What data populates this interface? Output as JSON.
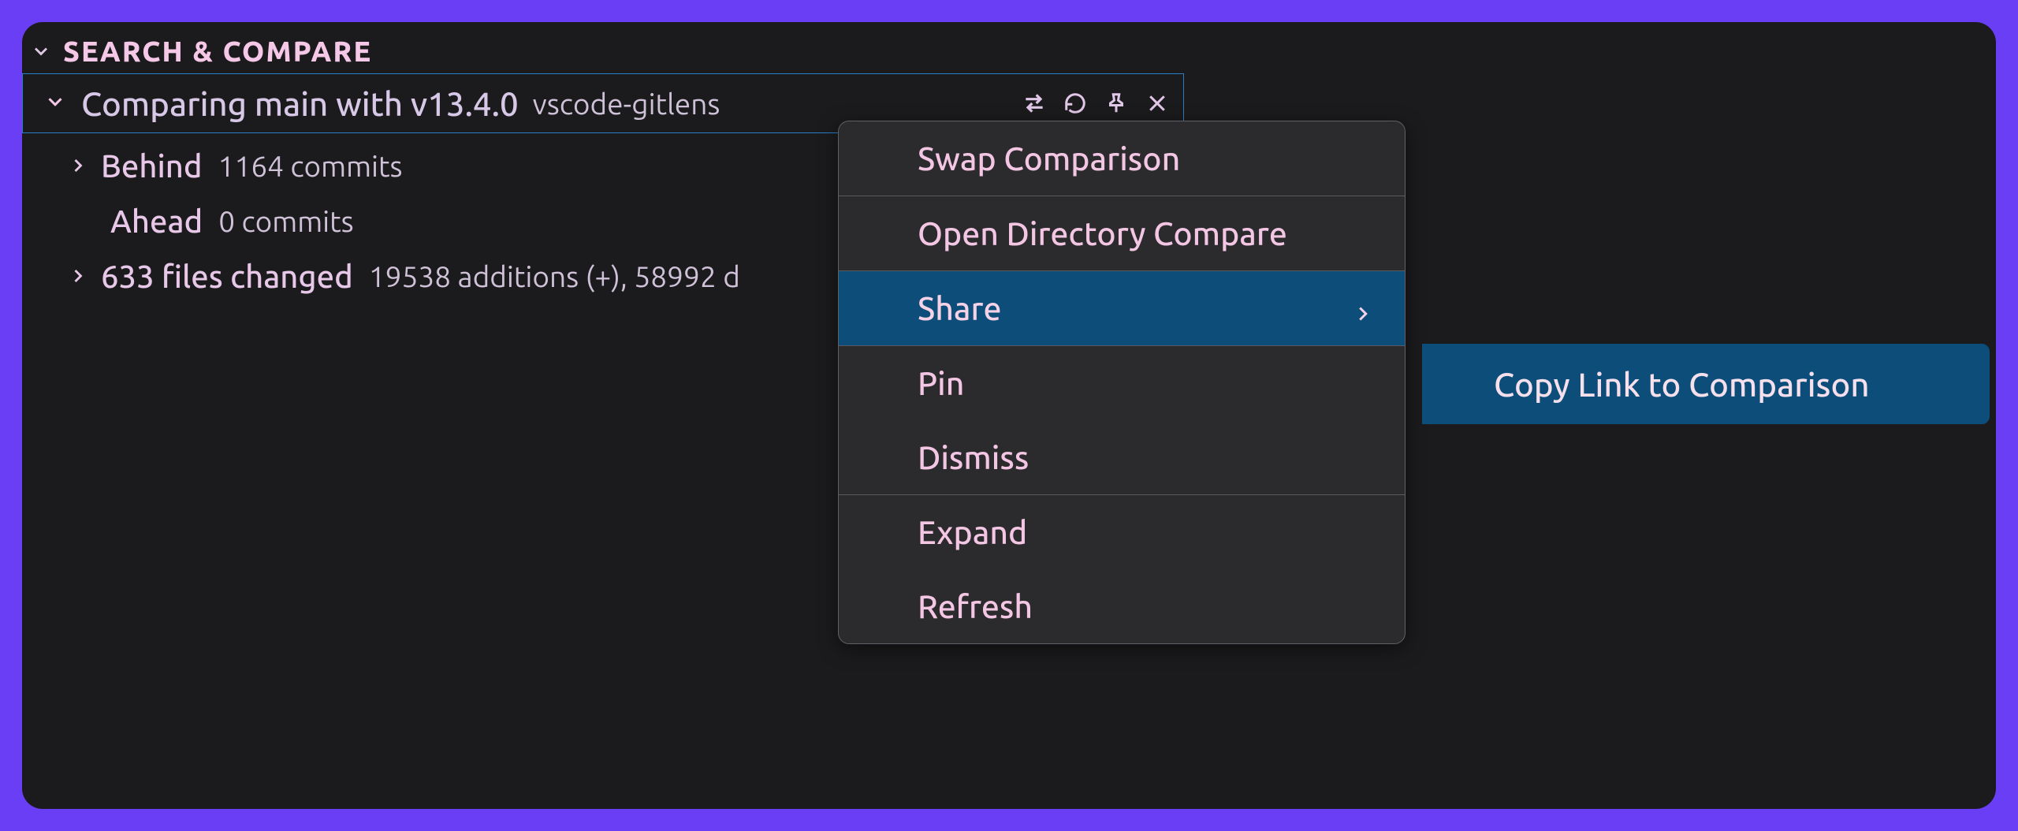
{
  "panel": {
    "title": "SEARCH & COMPARE"
  },
  "compare": {
    "label": "Comparing main with v13.4.0",
    "sub": "vscode-gitlens"
  },
  "tree": {
    "behind": {
      "name": "Behind",
      "detail": "1164 commits"
    },
    "ahead": {
      "name": "Ahead",
      "detail": "0 commits"
    },
    "files": {
      "name": "633 files changed",
      "detail": "19538 additions (+), 58992 d"
    }
  },
  "menu": {
    "swap": "Swap Comparison",
    "opendir": "Open Directory Compare",
    "share": "Share",
    "pin": "Pin",
    "dismiss": "Dismiss",
    "expand": "Expand",
    "refresh": "Refresh"
  },
  "submenu": {
    "copylink": "Copy Link to Comparison"
  }
}
